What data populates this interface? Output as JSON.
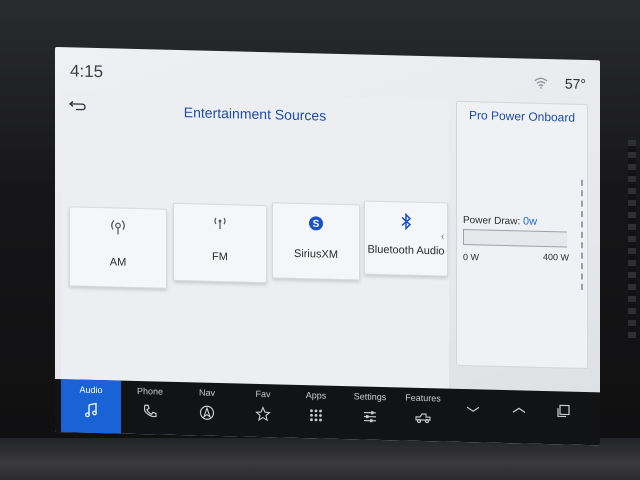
{
  "status": {
    "time": "4:15",
    "temperature": "57°",
    "wifi_icon": "wifi-icon"
  },
  "main": {
    "title": "Entertainment Sources",
    "back_icon": "back-arrow-icon",
    "sources": [
      {
        "label": "AM",
        "icon": "am-antenna-icon"
      },
      {
        "label": "FM",
        "icon": "fm-antenna-icon"
      },
      {
        "label": "SiriusXM",
        "icon": "siriusxm-icon"
      },
      {
        "label": "Bluetooth Audio",
        "icon": "bluetooth-icon"
      }
    ]
  },
  "power": {
    "title": "Pro Power Onboard",
    "draw_label": "Power Draw:",
    "draw_value": "0w",
    "min_label": "0 W",
    "max_label": "400 W",
    "fill_fraction": 0
  },
  "nav": {
    "items": [
      {
        "label": "Audio",
        "icon": "music-note-icon",
        "active": true
      },
      {
        "label": "Phone",
        "icon": "phone-icon",
        "active": false
      },
      {
        "label": "Nav",
        "icon": "navigation-icon",
        "active": false
      },
      {
        "label": "Fav",
        "icon": "star-icon",
        "active": false
      },
      {
        "label": "Apps",
        "icon": "apps-grid-icon",
        "active": false
      },
      {
        "label": "Settings",
        "icon": "settings-sliders-icon",
        "active": false
      },
      {
        "label": "Features",
        "icon": "truck-icon",
        "active": false
      },
      {
        "label": "",
        "icon": "chevron-down-icon",
        "active": false
      },
      {
        "label": "",
        "icon": "chevron-up-icon",
        "active": false
      },
      {
        "label": "",
        "icon": "screens-icon",
        "active": false
      }
    ]
  },
  "colors": {
    "accent": "#1a63d6",
    "title_blue": "#1f4ca8"
  }
}
